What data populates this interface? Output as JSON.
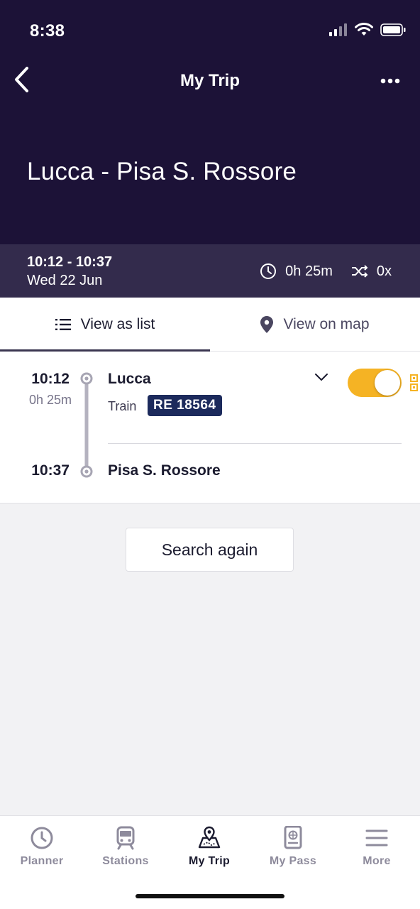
{
  "status_bar": {
    "time": "8:38"
  },
  "nav": {
    "title": "My Trip"
  },
  "route": {
    "title": "Lucca - Pisa S. Rossore"
  },
  "summary": {
    "times": "10:12 - 10:37",
    "date": "Wed 22 Jun",
    "duration": "0h 25m",
    "changes": "0x"
  },
  "tabs": [
    {
      "label": "View as list",
      "icon": "list-icon",
      "active": true
    },
    {
      "label": "View on map",
      "icon": "map-pin-icon",
      "active": false
    }
  ],
  "journey": {
    "departure_time": "10:12",
    "duration": "0h 25m",
    "departure_station": "Lucca",
    "mode": "Train",
    "train_number": "RE 18564",
    "arrival_time": "10:37",
    "arrival_station": "Pisa S. Rossore",
    "toggle_on": true
  },
  "actions": {
    "search_again": "Search again"
  },
  "tabbar": [
    {
      "label": "Planner",
      "icon": "clock-icon",
      "active": false
    },
    {
      "label": "Stations",
      "icon": "train-icon",
      "active": false
    },
    {
      "label": "My Trip",
      "icon": "map-icon",
      "active": true
    },
    {
      "label": "My Pass",
      "icon": "passport-icon",
      "active": false
    },
    {
      "label": "More",
      "icon": "menu-icon",
      "active": false
    }
  ],
  "colors": {
    "header_bg": "#1c1237",
    "summary_bg": "#332b4c",
    "accent_yellow": "#f5b324",
    "badge_bg": "#1c2a5c"
  }
}
